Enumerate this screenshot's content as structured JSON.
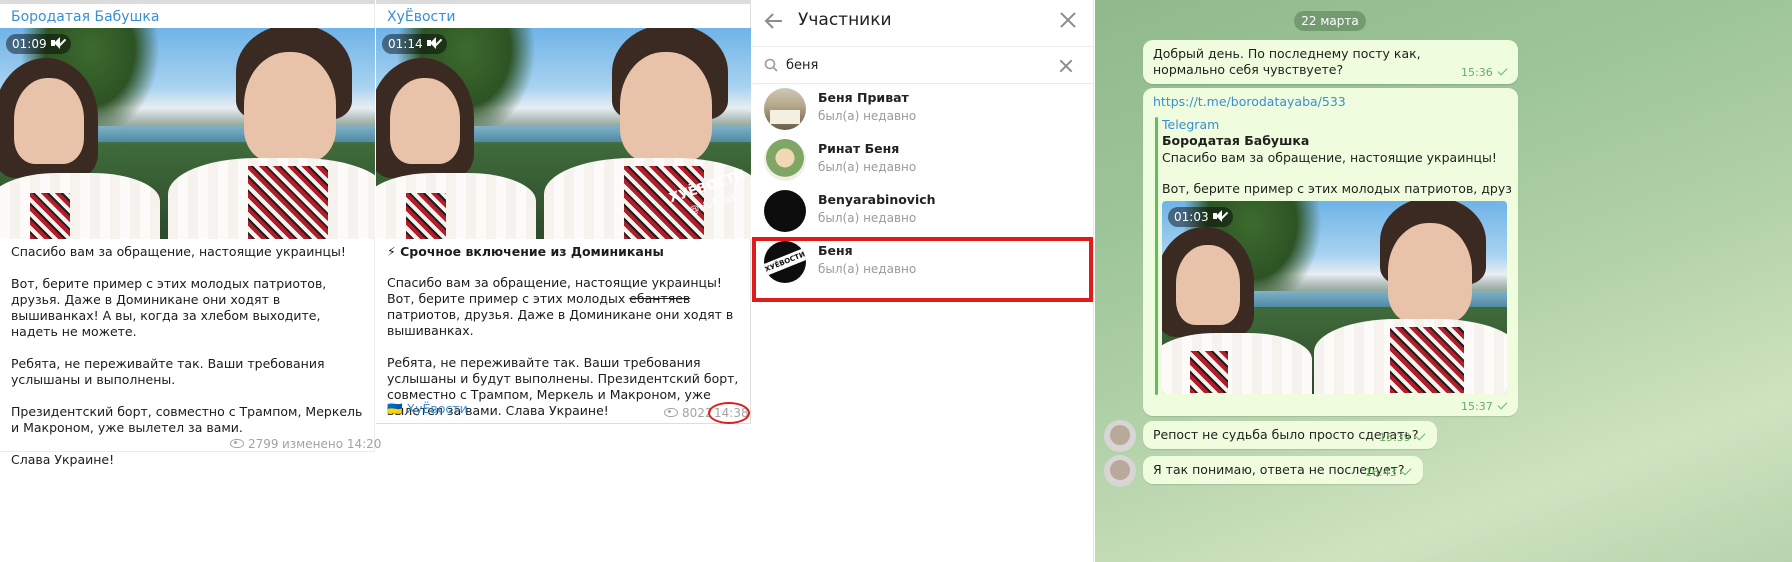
{
  "post1": {
    "channel": "Бородатая Бабушка",
    "duration": "01:09",
    "text": "Спасибо вам за обращение, настоящие украинцы!\n\nВот, берите пример с этих молодых патриотов, друзья. Даже в Доминикане они ходят в вышиванках! А вы, когда за хлебом выходите, надеть не можете.\n\nРебята, не переживайте так. Ваши требования услышаны и выполнены.\n\nПрезидентский борт, совместно с Трампом, Меркель и Макроном, уже вылетел за вами.\n\nСлава Украине!",
    "views": "2799",
    "edited": "изменено 14:20"
  },
  "post2": {
    "channel": "ХуЁвости",
    "duration": "01:14",
    "watermark": "ХУЁВОСТИ",
    "watermark_handle": "@HuE_ua",
    "headline": "⚡ Срочное включение из Доминиканы",
    "body_part1": "Спасибо вам за обращение, настоящие украинцы! Вот, берите пример с этих молодых ",
    "body_strike": "ебантяев",
    "body_part2": " патриотов, друзья. Даже в Доминикане они ходят в вышиванках.\n\nРебята, не переживайте так. Ваши требования услышаны и будут выполнены. Президентский борт, совместно с Трампом, Меркель и Макроном, уже вылетел за вами. Слава Украине!",
    "signature": "🇺🇦 ХуЁвости",
    "views": "8022",
    "time": "14:38"
  },
  "members": {
    "title": "Участники",
    "search_value": "беня",
    "list": [
      {
        "name": "Беня Приват",
        "status": "был(а) недавно"
      },
      {
        "name": "Ринат Беня",
        "status": "был(а) недавно"
      },
      {
        "name": "Benyarabinovich",
        "status": "был(а) недавно"
      },
      {
        "name": "Беня",
        "status": "был(а) недавно",
        "avatar_text": "ХУЁВОСТИ"
      }
    ]
  },
  "chat": {
    "date": "22 марта",
    "msg1": {
      "text": "Добрый день. По последнему посту как, нормально себя чувствуете?",
      "time": "15:36"
    },
    "msg2": {
      "link": "https://t.me/borodatayaba/533",
      "source": "Telegram",
      "title": "Бородатая Бабушка",
      "line1": "Спасибо вам за обращение, настоящие украинцы!",
      "line2": "Вот, берите пример с этих молодых патриотов, друзья. Даже ...",
      "duration": "01:03",
      "time": "15:37"
    },
    "msg3": {
      "text": "Репост не судьба было просто сделать?",
      "time": "15:39"
    },
    "msg4": {
      "text": "Я так понимаю, ответа не последует?",
      "time": "16:43"
    }
  },
  "colors": {
    "accent": "#3a8fcf",
    "highlight": "#e01b1b",
    "bubble": "#effdde"
  }
}
